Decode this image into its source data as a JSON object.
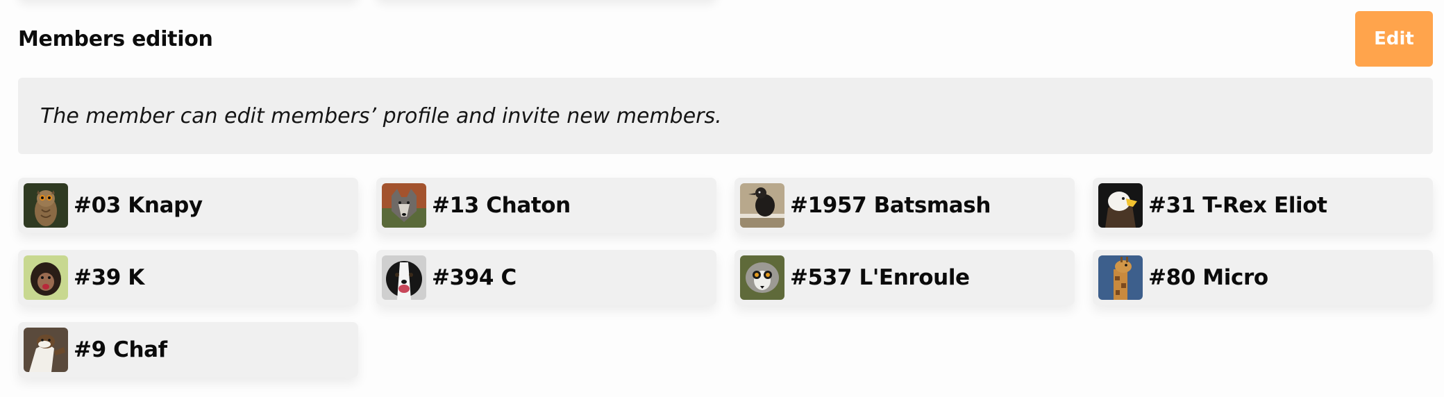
{
  "section": {
    "title": "Members edition",
    "edit_label": "Edit",
    "description": "The member can edit members’ profile and invite new members."
  },
  "members": [
    {
      "label": "#03 Knapy",
      "avatar_icon": "owl-avatar-icon"
    },
    {
      "label": "#13 Chaton",
      "avatar_icon": "wolf-avatar-icon"
    },
    {
      "label": "#1957 Batsmash",
      "avatar_icon": "bird-avatar-icon"
    },
    {
      "label": "#31 T-Rex Eliot",
      "avatar_icon": "eagle-avatar-icon"
    },
    {
      "label": "#39 K",
      "avatar_icon": "monkey-avatar-icon"
    },
    {
      "label": "#394 C",
      "avatar_icon": "dog-avatar-icon"
    },
    {
      "label": "#537 L'Enroule",
      "avatar_icon": "lemur-avatar-icon"
    },
    {
      "label": "#80 Micro",
      "avatar_icon": "giraffe-avatar-icon"
    },
    {
      "label": "#9 Chaf",
      "avatar_icon": "stoat-avatar-icon"
    }
  ],
  "colors": {
    "accent": "#ffa44c",
    "panel": "#efefef",
    "text": "#111111"
  }
}
